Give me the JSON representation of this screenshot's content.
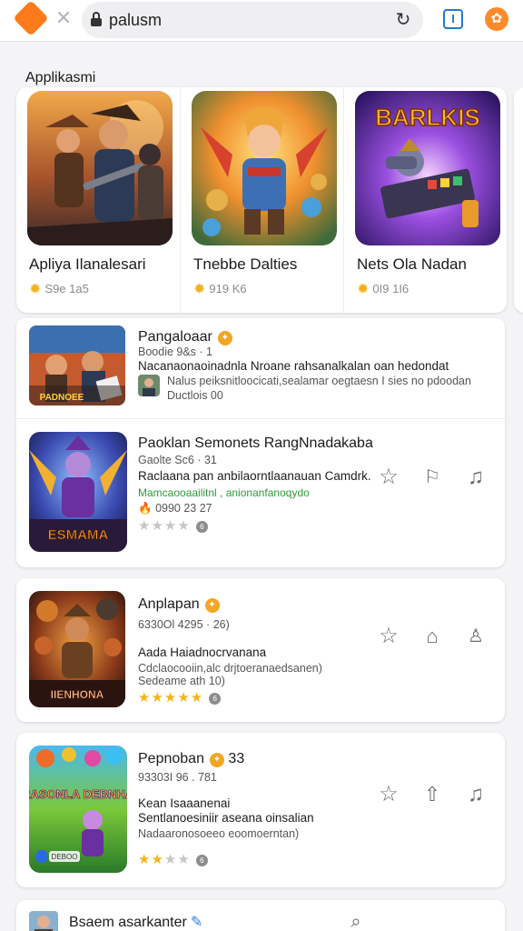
{
  "browser": {
    "address": "palusm"
  },
  "featured": {
    "section_title": "Applikasmi",
    "apps": [
      {
        "name": "Apliya Ilanalesari",
        "meta": "S9e 1a5",
        "banner": ""
      },
      {
        "name": "Tnebbe Dalties",
        "meta": "919 K6",
        "banner": ""
      },
      {
        "name": "Nets Ola Nadan",
        "meta": "0I9 1I6",
        "banner": "BARLKIS"
      }
    ]
  },
  "list1": {
    "rows": [
      {
        "title": "Pangaloaar",
        "sub": "Boodie 9&s",
        "sub_extra": "1",
        "desc": "Nacanaonaoinadnla Nroane rahsanalkalan oan hedondat",
        "desc2": "Nalus peiksnitloocicati,sealamar oegtaesn I sies no pdoodan",
        "meta": "Ductlois 00",
        "thumb_text": "PADNOEE"
      },
      {
        "title": "Paoklan Semonets RangNnadakaba",
        "sub": "Gaolte Sc6",
        "sub_extra": "31",
        "desc": "Raclaana pan anbilaorntlaanauan Camdrk.",
        "green": "Mamcaooaailitnl , anionanfanoqydo",
        "meta": "0990 23 27",
        "stars_on": 0,
        "stars_total": 4,
        "count": "6",
        "thumb_text": "ESMAMA"
      }
    ]
  },
  "card2": {
    "title": "Anplapan",
    "sub": "6330Ol 4295 · 26)",
    "desc": "Aada Haiadnocrvanana",
    "desc2": "Cdclaocooiin,alc drjtoeranaedsanen)",
    "desc3": "Sedeame ath 10)",
    "stars_on": 5,
    "stars_total": 5,
    "count": "6",
    "thumb_text": "IIENHONA"
  },
  "card3": {
    "title": "Pepnoban",
    "title_extra": "33",
    "sub": "93303I 96 . 781",
    "desc": "Kean Isaaanenai",
    "desc2": "Sentlanoesiniir aseana oinsalian",
    "desc3": "Nadaaronosoeeo eoomoerntan)",
    "stars_on": 2,
    "stars_total": 4,
    "count": "6",
    "thumb_text": "PRASONLA DEBNHAN",
    "thumb_sub": "DEBOO"
  },
  "card4": {
    "title": "Bsaem asarkanter"
  },
  "colors": {
    "accent": "#ff7a1a",
    "star": "#f4b41a",
    "link": "#1e7ad6"
  }
}
